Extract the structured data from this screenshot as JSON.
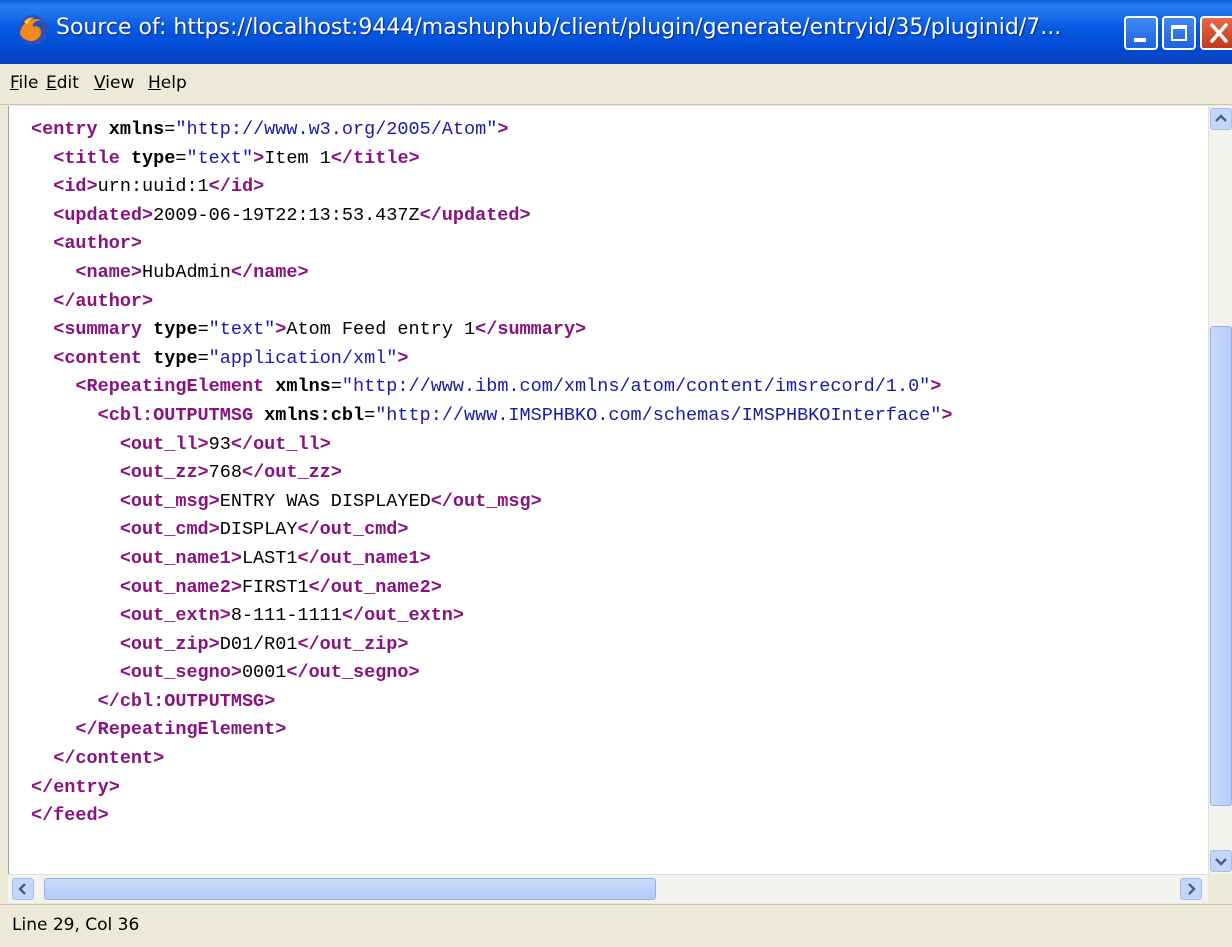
{
  "window": {
    "title": "Source of: https://localhost:9444/mashuphub/client/plugin/generate/entryid/35/pluginid/7..."
  },
  "menu": {
    "items": [
      {
        "first": "F",
        "rest": "ile"
      },
      {
        "first": "E",
        "rest": "dit"
      },
      {
        "first": "V",
        "rest": "iew"
      },
      {
        "first": "H",
        "rest": "elp"
      }
    ]
  },
  "source": {
    "lines": [
      [
        {
          "t": "tag",
          "s": "<entry"
        },
        {
          "t": "attr",
          "s": " xmlns"
        },
        {
          "t": "plain",
          "s": "="
        },
        {
          "t": "val",
          "s": "\"http://www.w3.org/2005/Atom\""
        },
        {
          "t": "tag",
          "s": ">"
        }
      ],
      [
        {
          "t": "plain",
          "s": "  "
        },
        {
          "t": "tag",
          "s": "<title"
        },
        {
          "t": "attr",
          "s": " type"
        },
        {
          "t": "plain",
          "s": "="
        },
        {
          "t": "val",
          "s": "\"text\""
        },
        {
          "t": "tag",
          "s": ">"
        },
        {
          "t": "plain",
          "s": "Item 1"
        },
        {
          "t": "tag",
          "s": "</title>"
        }
      ],
      [
        {
          "t": "plain",
          "s": "  "
        },
        {
          "t": "tag",
          "s": "<id>"
        },
        {
          "t": "plain",
          "s": "urn:uuid:1"
        },
        {
          "t": "tag",
          "s": "</id>"
        }
      ],
      [
        {
          "t": "plain",
          "s": "  "
        },
        {
          "t": "tag",
          "s": "<updated>"
        },
        {
          "t": "plain",
          "s": "2009-06-19T22:13:53.437Z"
        },
        {
          "t": "tag",
          "s": "</updated>"
        }
      ],
      [
        {
          "t": "plain",
          "s": "  "
        },
        {
          "t": "tag",
          "s": "<author>"
        }
      ],
      [
        {
          "t": "plain",
          "s": "    "
        },
        {
          "t": "tag",
          "s": "<name>"
        },
        {
          "t": "plain",
          "s": "HubAdmin"
        },
        {
          "t": "tag",
          "s": "</name>"
        }
      ],
      [
        {
          "t": "plain",
          "s": "  "
        },
        {
          "t": "tag",
          "s": "</author>"
        }
      ],
      [
        {
          "t": "plain",
          "s": "  "
        },
        {
          "t": "tag",
          "s": "<summary"
        },
        {
          "t": "attr",
          "s": " type"
        },
        {
          "t": "plain",
          "s": "="
        },
        {
          "t": "val",
          "s": "\"text\""
        },
        {
          "t": "tag",
          "s": ">"
        },
        {
          "t": "plain",
          "s": "Atom Feed entry 1"
        },
        {
          "t": "tag",
          "s": "</summary>"
        }
      ],
      [
        {
          "t": "plain",
          "s": "  "
        },
        {
          "t": "tag",
          "s": "<content"
        },
        {
          "t": "attr",
          "s": " type"
        },
        {
          "t": "plain",
          "s": "="
        },
        {
          "t": "val",
          "s": "\"application/xml\""
        },
        {
          "t": "tag",
          "s": ">"
        }
      ],
      [
        {
          "t": "plain",
          "s": "    "
        },
        {
          "t": "tag",
          "s": "<RepeatingElement"
        },
        {
          "t": "attr",
          "s": " xmlns"
        },
        {
          "t": "plain",
          "s": "="
        },
        {
          "t": "val",
          "s": "\"http://www.ibm.com/xmlns/atom/content/imsrecord/1.0\""
        },
        {
          "t": "tag",
          "s": ">"
        }
      ],
      [
        {
          "t": "plain",
          "s": "      "
        },
        {
          "t": "tag",
          "s": "<cbl:OUTPUTMSG"
        },
        {
          "t": "attr",
          "s": " xmlns:cbl"
        },
        {
          "t": "plain",
          "s": "="
        },
        {
          "t": "val",
          "s": "\"http://www.IMSPHBKO.com/schemas/IMSPHBKOInterface\""
        },
        {
          "t": "tag",
          "s": ">"
        }
      ],
      [
        {
          "t": "plain",
          "s": "        "
        },
        {
          "t": "tag",
          "s": "<out_ll>"
        },
        {
          "t": "plain",
          "s": "93"
        },
        {
          "t": "tag",
          "s": "</out_ll>"
        }
      ],
      [
        {
          "t": "plain",
          "s": "        "
        },
        {
          "t": "tag",
          "s": "<out_zz>"
        },
        {
          "t": "plain",
          "s": "768"
        },
        {
          "t": "tag",
          "s": "</out_zz>"
        }
      ],
      [
        {
          "t": "plain",
          "s": "        "
        },
        {
          "t": "tag",
          "s": "<out_msg>"
        },
        {
          "t": "plain",
          "s": "ENTRY WAS DISPLAYED"
        },
        {
          "t": "tag",
          "s": "</out_msg>"
        }
      ],
      [
        {
          "t": "plain",
          "s": "        "
        },
        {
          "t": "tag",
          "s": "<out_cmd>"
        },
        {
          "t": "plain",
          "s": "DISPLAY"
        },
        {
          "t": "tag",
          "s": "</out_cmd>"
        }
      ],
      [
        {
          "t": "plain",
          "s": "        "
        },
        {
          "t": "tag",
          "s": "<out_name1>"
        },
        {
          "t": "plain",
          "s": "LAST1"
        },
        {
          "t": "tag",
          "s": "</out_name1>"
        }
      ],
      [
        {
          "t": "plain",
          "s": "        "
        },
        {
          "t": "tag",
          "s": "<out_name2>"
        },
        {
          "t": "plain",
          "s": "FIRST1"
        },
        {
          "t": "tag",
          "s": "</out_name2>"
        }
      ],
      [
        {
          "t": "plain",
          "s": "        "
        },
        {
          "t": "tag",
          "s": "<out_extn>"
        },
        {
          "t": "plain",
          "s": "8-111-1111"
        },
        {
          "t": "tag",
          "s": "</out_extn>"
        }
      ],
      [
        {
          "t": "plain",
          "s": "        "
        },
        {
          "t": "tag",
          "s": "<out_zip>"
        },
        {
          "t": "plain",
          "s": "D01/R01"
        },
        {
          "t": "tag",
          "s": "</out_zip>"
        }
      ],
      [
        {
          "t": "plain",
          "s": "        "
        },
        {
          "t": "tag",
          "s": "<out_segno>"
        },
        {
          "t": "plain",
          "s": "0001"
        },
        {
          "t": "tag",
          "s": "</out_segno>"
        }
      ],
      [
        {
          "t": "plain",
          "s": "      "
        },
        {
          "t": "tag",
          "s": "</cbl:OUTPUTMSG>"
        }
      ],
      [
        {
          "t": "plain",
          "s": "    "
        },
        {
          "t": "tag",
          "s": "</RepeatingElement>"
        }
      ],
      [
        {
          "t": "plain",
          "s": "  "
        },
        {
          "t": "tag",
          "s": "</content>"
        }
      ],
      [
        {
          "t": "tag",
          "s": "</entry>"
        }
      ],
      [
        {
          "t": "tag",
          "s": "</feed>"
        }
      ]
    ]
  },
  "status": {
    "text": "Line 29, Col 36"
  },
  "colors": {
    "tag": "#881280",
    "attr_value": "#1A1AA6",
    "titlebar": "#0558E3"
  },
  "icons": {
    "app": "firefox-icon",
    "minimize": "minimize-icon",
    "maximize": "maximize-icon",
    "close": "close-icon",
    "scroll_up": "arrow-up-icon",
    "scroll_down": "arrow-down-icon",
    "scroll_left": "arrow-left-icon",
    "scroll_right": "arrow-right-icon"
  }
}
